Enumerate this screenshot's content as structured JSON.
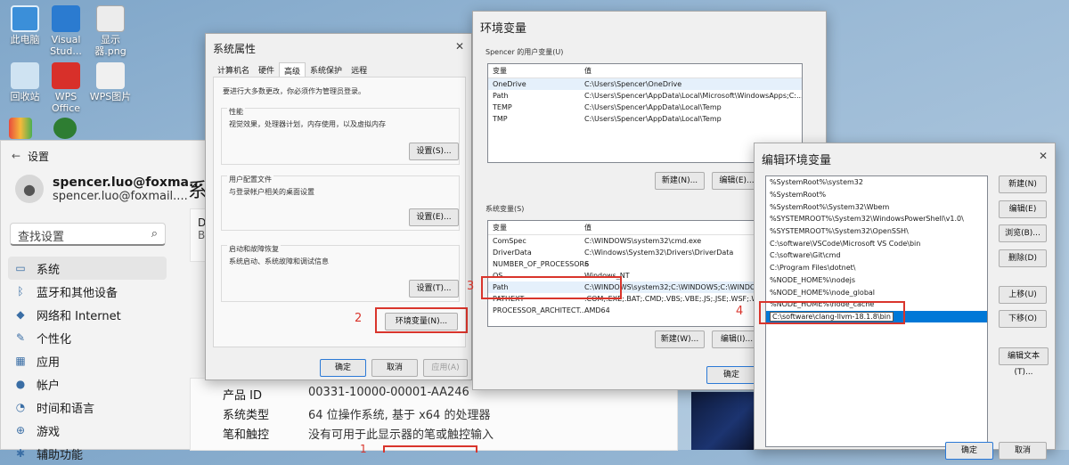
{
  "desktop": {
    "icons": [
      {
        "label": "此电脑",
        "icon": "monitor-icon",
        "color": "#3b8fd9"
      },
      {
        "label": "Visual Stud...",
        "icon": "vscode-icon",
        "color": "#2b7bd0"
      },
      {
        "label": "显示器.png",
        "icon": "image-file-icon",
        "color": "#e8e8e8"
      },
      {
        "label": "回收站",
        "icon": "recycle-bin-icon",
        "color": "#cfe3f2"
      },
      {
        "label": "WPS Office",
        "icon": "wps-icon",
        "color": "#d8302a"
      },
      {
        "label": "WPS图片",
        "icon": "wps-picture-icon",
        "color": "#f0f0f0"
      }
    ]
  },
  "settings": {
    "title": "设置",
    "user_name": "spencer.luo@foxma...",
    "user_email": "spencer.luo@foxmail....",
    "search_placeholder": "查找设置",
    "page_title": "系",
    "device_card_line1": "D",
    "device_card_line2": "B",
    "nav": [
      {
        "label": "系统",
        "icon": "system-icon",
        "active": true
      },
      {
        "label": "蓝牙和其他设备",
        "icon": "bluetooth-icon"
      },
      {
        "label": "网络和 Internet",
        "icon": "network-icon"
      },
      {
        "label": "个性化",
        "icon": "brush-icon"
      },
      {
        "label": "应用",
        "icon": "apps-icon"
      },
      {
        "label": "帐户",
        "icon": "account-icon"
      },
      {
        "label": "时间和语言",
        "icon": "clock-icon"
      },
      {
        "label": "游戏",
        "icon": "gamepad-icon"
      },
      {
        "label": "辅助功能",
        "icon": "accessibility-icon"
      }
    ],
    "info": [
      {
        "key": "产品 ID",
        "value": "00331-10000-00001-AA246"
      },
      {
        "key": "系统类型",
        "value": "64 位操作系统, 基于 x64 的处理器"
      },
      {
        "key": "笔和触控",
        "value": "没有可用于此显示器的笔或触控输入"
      }
    ]
  },
  "sysprop": {
    "title": "系统属性",
    "tabs": [
      "计算机名",
      "硬件",
      "高级",
      "系统保护",
      "远程"
    ],
    "active_tab": 2,
    "admin_note": "要进行大多数更改，你必须作为管理员登录。",
    "perf_label": "性能",
    "perf_desc": "视觉效果，处理器计划，内存使用，以及虚拟内存",
    "perf_btn": "设置(S)...",
    "profile_label": "用户配置文件",
    "profile_desc": "与登录帐户相关的桌面设置",
    "profile_btn": "设置(E)...",
    "startup_label": "启动和故障恢复",
    "startup_desc": "系统启动、系统故障和调试信息",
    "startup_btn": "设置(T)...",
    "envvar_btn": "环境变量(N)...",
    "ok": "确定",
    "cancel": "取消",
    "apply": "应用(A)"
  },
  "envvar": {
    "title": "环境变量",
    "user_group": "Spencer 的用户变量(U)",
    "col_var": "变量",
    "col_val": "值",
    "user_vars": [
      {
        "name": "OneDrive",
        "value": "C:\\Users\\Spencer\\OneDrive"
      },
      {
        "name": "Path",
        "value": "C:\\Users\\Spencer\\AppData\\Local\\Microsoft\\WindowsApps;C:..."
      },
      {
        "name": "TEMP",
        "value": "C:\\Users\\Spencer\\AppData\\Local\\Temp"
      },
      {
        "name": "TMP",
        "value": "C:\\Users\\Spencer\\AppData\\Local\\Temp"
      }
    ],
    "user_new": "新建(N)...",
    "user_edit": "编辑(E)...",
    "sys_group": "系统变量(S)",
    "sys_vars": [
      {
        "name": "ComSpec",
        "value": "C:\\WINDOWS\\system32\\cmd.exe"
      },
      {
        "name": "DriverData",
        "value": "C:\\Windows\\System32\\Drivers\\DriverData"
      },
      {
        "name": "NUMBER_OF_PROCESSORS",
        "value": "6"
      },
      {
        "name": "OS",
        "value": "Windows_NT"
      },
      {
        "name": "Path",
        "value": "C:\\WINDOWS\\system32;C:\\WINDOWS;C:\\WINDOW"
      },
      {
        "name": "PATHEXT",
        "value": ".COM;.EXE;.BAT;.CMD;.VBS;.VBE;.JS;.JSE;.WSF;.WSH"
      },
      {
        "name": "PROCESSOR_ARCHITECT...",
        "value": "AMD64"
      }
    ],
    "sys_new": "新建(W)...",
    "sys_edit": "编辑(I)...",
    "ok": "确定"
  },
  "editenv": {
    "title": "编辑环境变量",
    "entries": [
      "%SystemRoot%\\system32",
      "%SystemRoot%",
      "%SystemRoot%\\System32\\Wbem",
      "%SYSTEMROOT%\\System32\\WindowsPowerShell\\v1.0\\",
      "%SYSTEMROOT%\\System32\\OpenSSH\\",
      "C:\\software\\VSCode\\Microsoft VS Code\\bin",
      "C:\\software\\Git\\cmd",
      "C:\\Program Files\\dotnet\\",
      "%NODE_HOME%\\nodejs",
      "%NODE_HOME%\\node_global",
      "%NODE_HOME%\\node_cache",
      "C:\\software\\clang-llvm-18.1.8\\bin"
    ],
    "selected_index": 11,
    "btn_new": "新建(N)",
    "btn_edit": "编辑(E)",
    "btn_browse": "浏览(B)...",
    "btn_delete": "删除(D)",
    "btn_up": "上移(U)",
    "btn_down": "下移(O)",
    "btn_edit_text": "编辑文本(T)...",
    "ok": "确定",
    "cancel": "取消"
  },
  "annotations": [
    "1",
    "2",
    "3",
    "4"
  ],
  "colors": {
    "annotation": "#d9352c",
    "selection": "#0078d7",
    "accent": "#2b79d6"
  }
}
